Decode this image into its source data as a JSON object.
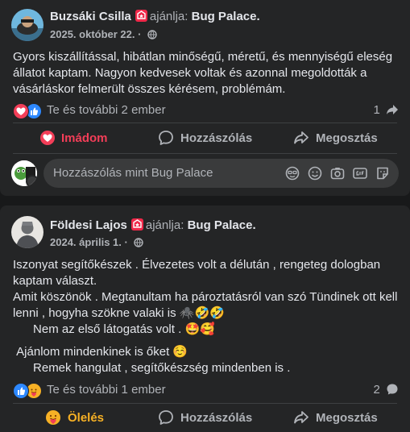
{
  "posts": [
    {
      "author": "Buzsáki Csilla",
      "verb": "ajánlja:",
      "page": "Bug Palace",
      "date": "2025. október 22.",
      "paragraphs": [
        "Gyors kiszállítással, hibátlan minőségű, méretű, és mennyiségű eleség állatot kaptam. Nagyon kedvesek voltak és azonnal megoldották a vásárláskor felmerült összes kérésem, problémám."
      ],
      "reactions_text": "Te és további 2 ember",
      "share_count": "1",
      "reaction_types": [
        "love",
        "like"
      ],
      "actions": {
        "react": "Imádom",
        "comment": "Hozzászólás",
        "share": "Megosztás"
      },
      "comment_placeholder": "Hozzászólás mint Bug Palace"
    },
    {
      "author": "Földesi Lajos",
      "verb": "ajánlja:",
      "page": "Bug Palace.",
      "date": "2024. április 1.",
      "paragraphs": [
        "Iszonyat segítőkészek . Élvezetes volt a délután , rengeteg dologban kaptam választ.",
        "Amit köszönök . Megtanultam ha pároztatásról van szó Tündinek ott kell lenni , hogyha szökne valaki is 🕷️🤣🤣",
        "      Nem az első látogatás volt . 🤩🥰",
        " Ajánlom mindenkinek is őket ☺️",
        "      Remek hangulat , segítőkészség mindenben is ."
      ],
      "reactions_text": "Te és további 1 ember",
      "comment_count": "2",
      "reaction_types": [
        "like",
        "care"
      ],
      "actions": {
        "react": "Ölelés",
        "comment": "Hozzászólás",
        "share": "Megosztás"
      }
    }
  ],
  "colors": {
    "background": "#18191a",
    "card": "#242526",
    "love": "#f33e58",
    "like": "#2d88ff",
    "care": "#f7b125",
    "muted": "#b0b3b8"
  }
}
